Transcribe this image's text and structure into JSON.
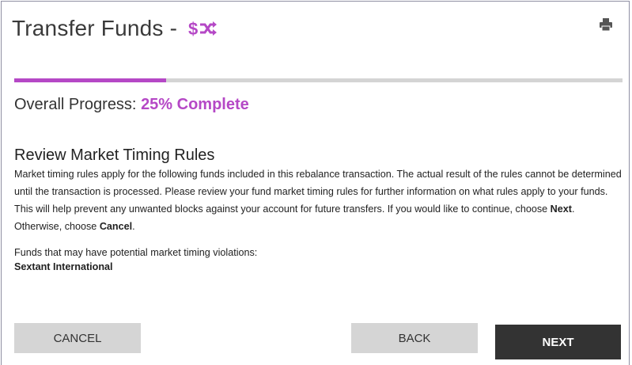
{
  "header": {
    "title": "Transfer Funds -",
    "title_icon": "dollar-shuffle-icon",
    "print_icon": "printer-icon"
  },
  "progress": {
    "label": "Overall Progress:",
    "percent_text": "25% Complete",
    "fraction": 0.25
  },
  "section": {
    "heading": "Review Market Timing Rules",
    "paragraph_main": "Market timing rules apply for the following funds included in this rebalance transaction. The actual result of the rules cannot be determined until the transaction is processed. Please review your fund market timing rules for further information on what rules apply to your funds. This will help prevent any unwanted blocks against your account for future transfers. If you would like to continue, choose ",
    "next_word": "Next",
    "otherwise_text": ". Otherwise, choose ",
    "cancel_word": "Cancel",
    "period": ".",
    "funds_label": "Funds that may have potential market timing violations:",
    "fund_name": "Sextant International"
  },
  "buttons": {
    "cancel_label": "CANCEL",
    "back_label": "BACK",
    "next_label": "NEXT"
  },
  "colors": {
    "accent": "#b548c6",
    "track": "#d4d4d4",
    "button_gray": "#d5d5d5",
    "button_dark": "#333333"
  }
}
